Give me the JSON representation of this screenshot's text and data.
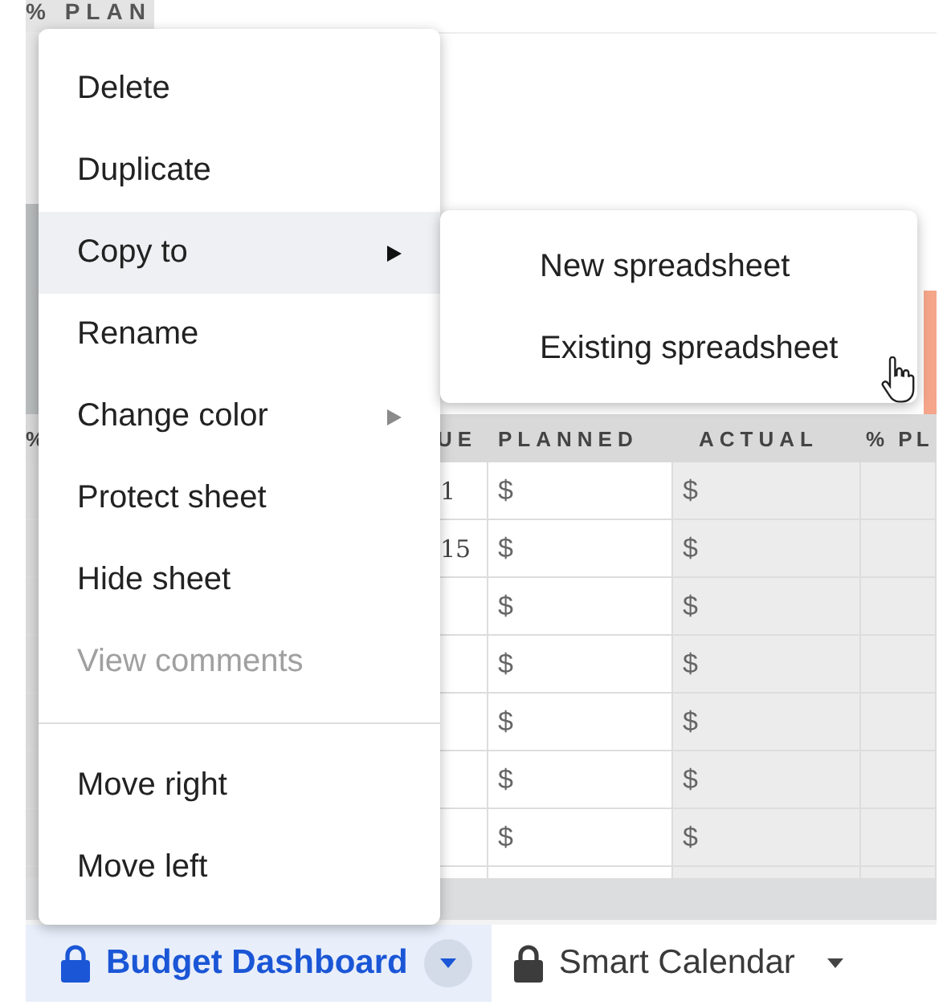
{
  "sheet": {
    "corner_header": "% PLAN",
    "columns": [
      "%",
      "UE",
      "PLANNED",
      "ACTUAL",
      "% PL"
    ],
    "rows": [
      {
        "column_2": "1",
        "planned": "$",
        "actual": "$"
      },
      {
        "column_2": "15",
        "planned": "$",
        "actual": "$"
      },
      {
        "planned": "$",
        "actual": "$"
      },
      {
        "planned": "$",
        "actual": "$"
      },
      {
        "planned": "$",
        "actual": "$"
      },
      {
        "planned": "$",
        "actual": "$"
      },
      {
        "planned": "$",
        "actual": "$"
      }
    ]
  },
  "context_menu": {
    "groups": [
      [
        {
          "label": "Delete",
          "has_submenu": false,
          "disabled": false,
          "selected": false
        },
        {
          "label": "Duplicate",
          "has_submenu": false,
          "disabled": false,
          "selected": false
        },
        {
          "label": "Copy to",
          "has_submenu": true,
          "disabled": false,
          "selected": true
        },
        {
          "label": "Rename",
          "has_submenu": false,
          "disabled": false,
          "selected": false
        },
        {
          "label": "Change color",
          "has_submenu": true,
          "disabled": false,
          "selected": false
        },
        {
          "label": "Protect sheet",
          "has_submenu": false,
          "disabled": false,
          "selected": false
        },
        {
          "label": "Hide sheet",
          "has_submenu": false,
          "disabled": false,
          "selected": false
        },
        {
          "label": "View comments",
          "has_submenu": false,
          "disabled": true,
          "selected": false
        }
      ],
      [
        {
          "label": "Move right",
          "has_submenu": false,
          "disabled": false,
          "selected": false
        },
        {
          "label": "Move left",
          "has_submenu": false,
          "disabled": false,
          "selected": false
        }
      ]
    ]
  },
  "submenu": {
    "items": [
      {
        "label": "New spreadsheet"
      },
      {
        "label": "Existing spreadsheet"
      }
    ]
  },
  "sheet_tabs": [
    {
      "label": "Budget Dashboard",
      "selected": true,
      "locked": true
    },
    {
      "label": "Smart Calendar",
      "selected": false,
      "locked": true
    }
  ]
}
